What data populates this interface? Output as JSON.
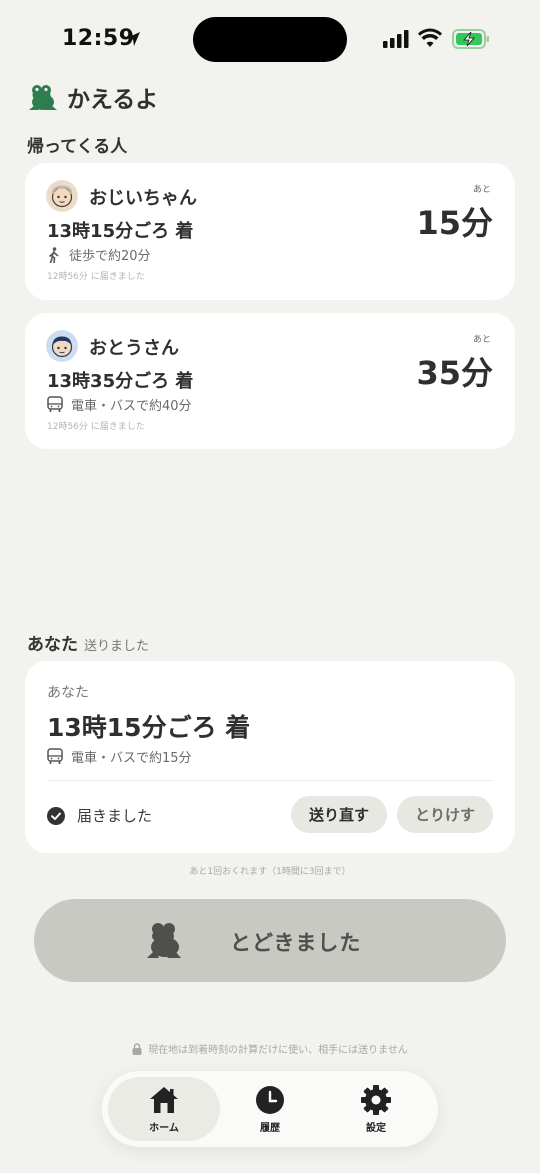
{
  "status_bar": {
    "time": "12:59"
  },
  "app": {
    "name": "かえるよ"
  },
  "returning": {
    "section_title": "帰ってくる人",
    "people": [
      {
        "name": "おじいちゃん",
        "arrival": "13時15分ごろ 着",
        "mode_icon": "walk-icon",
        "route": "徒歩で約20分",
        "received": "12時56分 に届きました",
        "remain_label": "あと",
        "remain_value": "15分"
      },
      {
        "name": "おとうさん",
        "arrival": "13時35分ごろ 着",
        "mode_icon": "bus-icon",
        "route": "電車・バスで約40分",
        "received": "12時56分 に届きました",
        "remain_label": "あと",
        "remain_value": "35分"
      }
    ]
  },
  "you": {
    "section_title": "あなた",
    "section_sub": "送りました",
    "name": "あなた",
    "arrival": "13時15分ごろ 着",
    "route": "電車・バスで約15分",
    "status": "届きました",
    "resend_label": "送り直す",
    "cancel_label": "とりけす",
    "remaining_note": "あと1回おくれます（1時間に3回まで）"
  },
  "main_button": {
    "label": "とどきました"
  },
  "privacy_note": "現在地は到着時刻の計算だけに使い、相手には送りません",
  "tabs": [
    {
      "label": "ホーム",
      "icon": "home-icon",
      "active": true
    },
    {
      "label": "履歴",
      "icon": "clock-icon",
      "active": false
    },
    {
      "label": "設定",
      "icon": "gear-icon",
      "active": false
    }
  ],
  "colors": {
    "background": "#f2f2ee",
    "brand_green": "#2e7d4f",
    "button_gray": "#c9c9c4",
    "battery_green": "#34c759"
  }
}
